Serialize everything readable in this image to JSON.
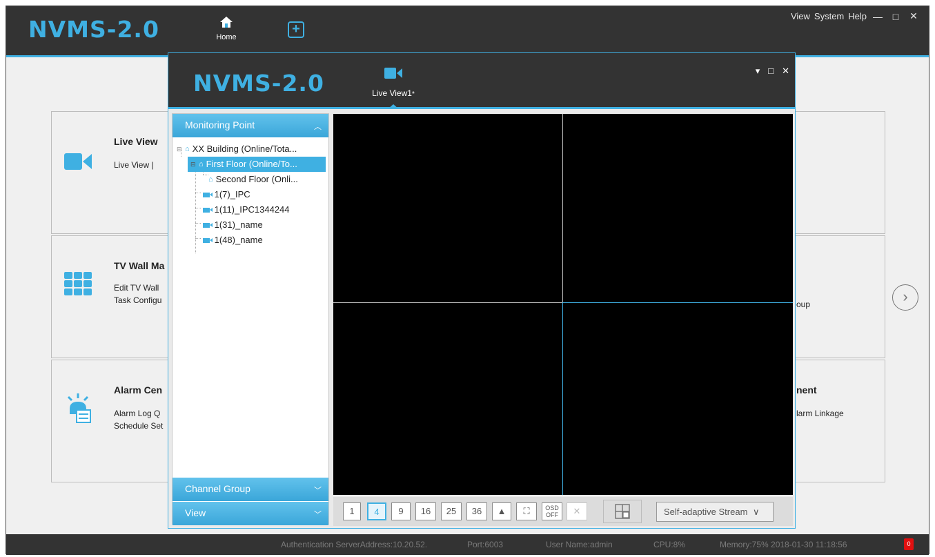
{
  "app": {
    "logo": "NVMS-2.0",
    "home_tab_label": "Home",
    "menu": [
      "View",
      "System",
      "Help"
    ],
    "window_controls": [
      "—",
      "□",
      "✕"
    ]
  },
  "home": {
    "cards": [
      {
        "title": "Live View",
        "lines": [
          "Live View  |"
        ],
        "icon": "camera-icon"
      },
      {
        "title": "TV Wall Ma",
        "lines": [
          "Edit TV Wall",
          "Task Configu"
        ],
        "icon": "tv-wall-icon"
      },
      {
        "title": "Alarm Cen",
        "lines": [
          "Alarm Log Q",
          "Schedule Set"
        ],
        "icon": "alarm-icon"
      }
    ],
    "right_cards": [
      {
        "title": "",
        "lines": []
      },
      {
        "title": "",
        "lines": [
          "oup"
        ]
      },
      {
        "title": "nent",
        "lines": [
          "larm Linkage"
        ]
      }
    ]
  },
  "live_view": {
    "logo": "NVMS-2.0",
    "tab_label": "Live View1",
    "tab_modified": "*",
    "panel_sections": {
      "monitoring": "Monitoring Point",
      "channel_group": "Channel Group",
      "view": "View"
    },
    "tree": {
      "building": "XX Building (Online/Tota...",
      "first_floor": "First Floor (Online/To...",
      "second_floor": "Second Floor (Onli...",
      "channels": [
        "1(7)_IPC",
        "1(11)_IPC1344244",
        "1(31)_name",
        "1(48)_name"
      ]
    },
    "toolbar": {
      "layouts": [
        "1",
        "4",
        "9",
        "16",
        "25",
        "36"
      ],
      "active_layout": "4",
      "osd_label": "OSD\nOFF",
      "stream_label": "Self-adaptive Stream"
    }
  },
  "status": {
    "auth": "Authentication ServerAddress:10.20.52.",
    "port": "Port:6003",
    "user": "User Name:admin",
    "cpu": "CPU:8%",
    "memory": "Memory:75% 2018-01-30 11:18:56",
    "badge": "0"
  }
}
